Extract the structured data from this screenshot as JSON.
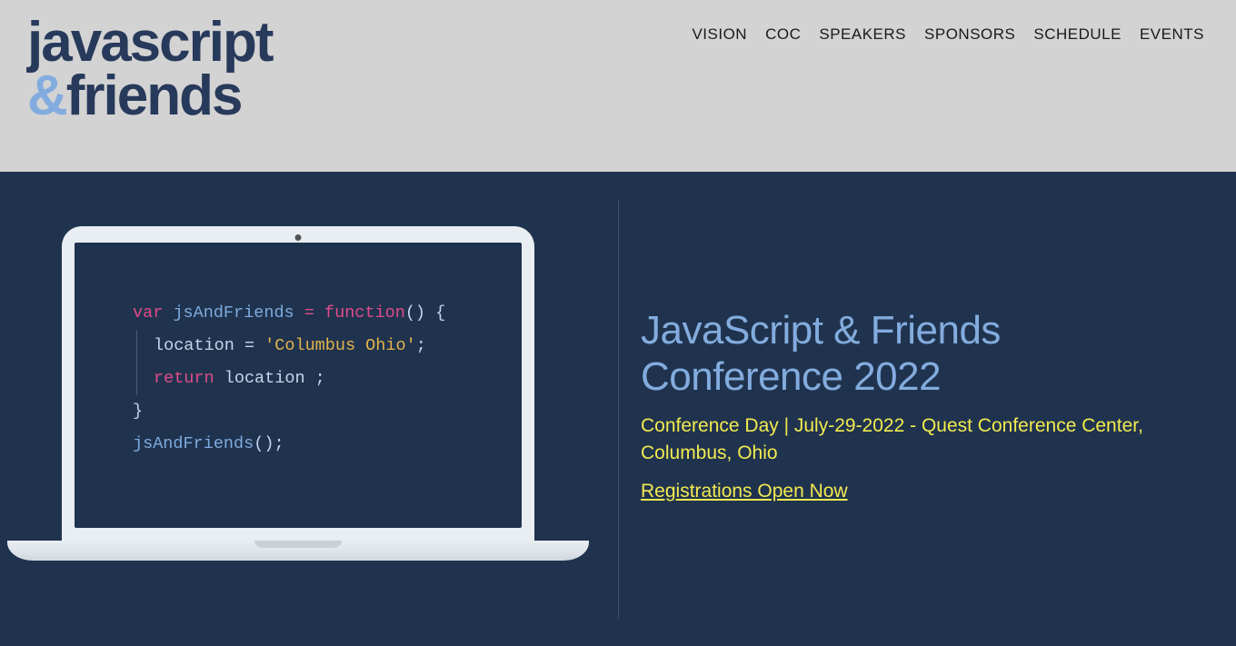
{
  "logo": {
    "line1": "javascript",
    "amp": "&",
    "line2": "friends"
  },
  "nav": {
    "items": [
      {
        "label": "VISION"
      },
      {
        "label": "COC"
      },
      {
        "label": "SPEAKERS"
      },
      {
        "label": "SPONSORS"
      },
      {
        "label": "SCHEDULE"
      },
      {
        "label": "EVENTS"
      }
    ]
  },
  "code": {
    "kw_var": "var",
    "fn_decl": "jsAndFriends",
    "op_assign": "=",
    "kw_function": "function",
    "parens_open": "() {",
    "loc_ident": "location",
    "loc_assign": "=",
    "loc_value": "'Columbus Ohio'",
    "semi": ";",
    "kw_return": "return",
    "ret_ident": "location",
    "ret_tail": " ;",
    "close_brace": "}",
    "call_name": "jsAndFriends",
    "call_tail": "();"
  },
  "hero": {
    "title": "JavaScript & Friends Conference 2022",
    "subtitle": "Conference Day |  July-29-2022 - Quest Conference Center, Columbus, Ohio",
    "register": "Registrations Open Now"
  }
}
